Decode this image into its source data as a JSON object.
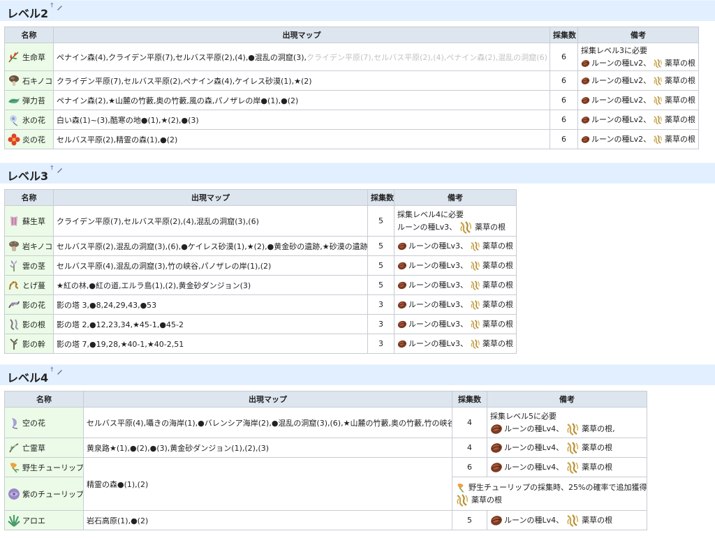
{
  "sections": [
    {
      "title": "レベル2"
    },
    {
      "title": "レベル3"
    },
    {
      "title": "レベル4"
    }
  ],
  "dagger": "†",
  "headers": {
    "name": "名称",
    "map": "出現マップ",
    "count": "採集数",
    "note": "備考"
  },
  "notes": {
    "rune_lv2": "ルーンの種Lv2、",
    "rune_lv3": "ルーンの種Lv3、",
    "rune_lv4": "ルーンの種Lv4、",
    "herb_root": "薬草の根",
    "herb_root_comma": "薬草の根,",
    "need_lv3": "採集レベル3に必要",
    "need_lv4": "採集レベル4に必要",
    "need_lv5": "採集レベル5に必要",
    "rune_lv3_plain": "ルーンの種Lv3、",
    "tulip_note": "野生チューリップの採集時、25%の確率で追加獲得"
  },
  "level2": [
    {
      "name": "生命草",
      "map": "ペナイン森(4),クライデン平原(7),セルバス平原(2),(4),●混乱の洞窟(3),",
      "map_gray": "クライデン平原(7),セルバス平原(2),(4),ペナイン森(2),混乱の洞窟(6)",
      "count": "6"
    },
    {
      "name": "石キノコ",
      "map": "クライデン平原(7),セルバス平原(2),ペナイン森(4),ケイレス砂漠(1),★(2)",
      "count": "6"
    },
    {
      "name": "弾力苔",
      "map": "ペナイン森(2),★山麓の竹藪,奥の竹藪,風の森,パノザレの岸●(1),●(2)",
      "count": "6"
    },
    {
      "name": "氷の花",
      "map": "白い森(1)~(3),酷寒の地●(1),★(2),●(3)",
      "count": "6"
    },
    {
      "name": "炎の花",
      "map": "セルバス平原(2),精霊の森(1),●(2)",
      "count": "6"
    }
  ],
  "level3": [
    {
      "name": "蘇生草",
      "map": "クライデン平原(7),セルバス平原(2),(4),混乱の洞窟(3),(6)",
      "count": "5"
    },
    {
      "name": "岩キノコ",
      "map": "セルバス平原(2),混乱の洞窟(3),(6),●ケイレス砂漠(1),★(2),●黄金砂の遺跡,★砂漠の遺跡",
      "count": "5"
    },
    {
      "name": "雲の茎",
      "map": "セルバス平原(4),混乱の洞窟(3),竹の峡谷,パノザレの岸(1),(2)",
      "count": "5"
    },
    {
      "name": "とげ蔓",
      "map": "★紅の林,●紅の道,エルラ島(1),(2),黄金砂ダンジョン(3)",
      "count": "5"
    },
    {
      "name": "影の花",
      "map": "影の塔 3,●8,24,29,43,●53",
      "count": "3"
    },
    {
      "name": "影の根",
      "map": "影の塔 2,●12,23,34,★45-1,●45-2",
      "count": "3"
    },
    {
      "name": "影の幹",
      "map": "影の塔 7,●19,28,★40-1,★40-2,51",
      "count": "3"
    }
  ],
  "level4": [
    {
      "name": "空の花",
      "map": "セルバス平原(4),囁きの海岸(1),●バレンシア海岸(2),●混乱の洞窟(3),(6),★山麓の竹藪,奥の竹藪,竹の峡谷",
      "count": "4"
    },
    {
      "name": "亡霊草",
      "map": "黄泉路★(1),●(2),●(3),黄金砂ダンジョン(1),(2),(3)",
      "count": "4"
    },
    {
      "name": "野生チューリップ",
      "map": "精霊の森●(1),(2)",
      "count": "6"
    },
    {
      "name": "紫のチューリップ"
    },
    {
      "name": "アロエ",
      "map": "岩石高原(1),●(2)",
      "count": "5"
    }
  ],
  "colors": {
    "header_bg": "#e2efff",
    "name_cell_bg": "#ebfbe7",
    "th_bg": "#dde6ef"
  }
}
